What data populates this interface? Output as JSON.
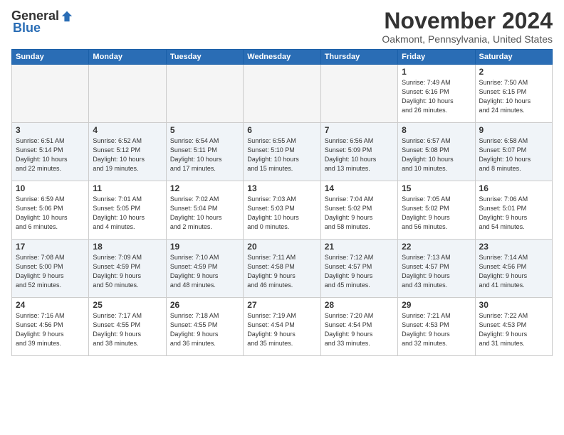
{
  "logo": {
    "general": "General",
    "blue": "Blue"
  },
  "header": {
    "month": "November 2024",
    "location": "Oakmont, Pennsylvania, United States"
  },
  "weekdays": [
    "Sunday",
    "Monday",
    "Tuesday",
    "Wednesday",
    "Thursday",
    "Friday",
    "Saturday"
  ],
  "weeks": [
    [
      {
        "day": "",
        "info": ""
      },
      {
        "day": "",
        "info": ""
      },
      {
        "day": "",
        "info": ""
      },
      {
        "day": "",
        "info": ""
      },
      {
        "day": "",
        "info": ""
      },
      {
        "day": "1",
        "info": "Sunrise: 7:49 AM\nSunset: 6:16 PM\nDaylight: 10 hours\nand 26 minutes."
      },
      {
        "day": "2",
        "info": "Sunrise: 7:50 AM\nSunset: 6:15 PM\nDaylight: 10 hours\nand 24 minutes."
      }
    ],
    [
      {
        "day": "3",
        "info": "Sunrise: 6:51 AM\nSunset: 5:14 PM\nDaylight: 10 hours\nand 22 minutes."
      },
      {
        "day": "4",
        "info": "Sunrise: 6:52 AM\nSunset: 5:12 PM\nDaylight: 10 hours\nand 19 minutes."
      },
      {
        "day": "5",
        "info": "Sunrise: 6:54 AM\nSunset: 5:11 PM\nDaylight: 10 hours\nand 17 minutes."
      },
      {
        "day": "6",
        "info": "Sunrise: 6:55 AM\nSunset: 5:10 PM\nDaylight: 10 hours\nand 15 minutes."
      },
      {
        "day": "7",
        "info": "Sunrise: 6:56 AM\nSunset: 5:09 PM\nDaylight: 10 hours\nand 13 minutes."
      },
      {
        "day": "8",
        "info": "Sunrise: 6:57 AM\nSunset: 5:08 PM\nDaylight: 10 hours\nand 10 minutes."
      },
      {
        "day": "9",
        "info": "Sunrise: 6:58 AM\nSunset: 5:07 PM\nDaylight: 10 hours\nand 8 minutes."
      }
    ],
    [
      {
        "day": "10",
        "info": "Sunrise: 6:59 AM\nSunset: 5:06 PM\nDaylight: 10 hours\nand 6 minutes."
      },
      {
        "day": "11",
        "info": "Sunrise: 7:01 AM\nSunset: 5:05 PM\nDaylight: 10 hours\nand 4 minutes."
      },
      {
        "day": "12",
        "info": "Sunrise: 7:02 AM\nSunset: 5:04 PM\nDaylight: 10 hours\nand 2 minutes."
      },
      {
        "day": "13",
        "info": "Sunrise: 7:03 AM\nSunset: 5:03 PM\nDaylight: 10 hours\nand 0 minutes."
      },
      {
        "day": "14",
        "info": "Sunrise: 7:04 AM\nSunset: 5:02 PM\nDaylight: 9 hours\nand 58 minutes."
      },
      {
        "day": "15",
        "info": "Sunrise: 7:05 AM\nSunset: 5:02 PM\nDaylight: 9 hours\nand 56 minutes."
      },
      {
        "day": "16",
        "info": "Sunrise: 7:06 AM\nSunset: 5:01 PM\nDaylight: 9 hours\nand 54 minutes."
      }
    ],
    [
      {
        "day": "17",
        "info": "Sunrise: 7:08 AM\nSunset: 5:00 PM\nDaylight: 9 hours\nand 52 minutes."
      },
      {
        "day": "18",
        "info": "Sunrise: 7:09 AM\nSunset: 4:59 PM\nDaylight: 9 hours\nand 50 minutes."
      },
      {
        "day": "19",
        "info": "Sunrise: 7:10 AM\nSunset: 4:59 PM\nDaylight: 9 hours\nand 48 minutes."
      },
      {
        "day": "20",
        "info": "Sunrise: 7:11 AM\nSunset: 4:58 PM\nDaylight: 9 hours\nand 46 minutes."
      },
      {
        "day": "21",
        "info": "Sunrise: 7:12 AM\nSunset: 4:57 PM\nDaylight: 9 hours\nand 45 minutes."
      },
      {
        "day": "22",
        "info": "Sunrise: 7:13 AM\nSunset: 4:57 PM\nDaylight: 9 hours\nand 43 minutes."
      },
      {
        "day": "23",
        "info": "Sunrise: 7:14 AM\nSunset: 4:56 PM\nDaylight: 9 hours\nand 41 minutes."
      }
    ],
    [
      {
        "day": "24",
        "info": "Sunrise: 7:16 AM\nSunset: 4:56 PM\nDaylight: 9 hours\nand 39 minutes."
      },
      {
        "day": "25",
        "info": "Sunrise: 7:17 AM\nSunset: 4:55 PM\nDaylight: 9 hours\nand 38 minutes."
      },
      {
        "day": "26",
        "info": "Sunrise: 7:18 AM\nSunset: 4:55 PM\nDaylight: 9 hours\nand 36 minutes."
      },
      {
        "day": "27",
        "info": "Sunrise: 7:19 AM\nSunset: 4:54 PM\nDaylight: 9 hours\nand 35 minutes."
      },
      {
        "day": "28",
        "info": "Sunrise: 7:20 AM\nSunset: 4:54 PM\nDaylight: 9 hours\nand 33 minutes."
      },
      {
        "day": "29",
        "info": "Sunrise: 7:21 AM\nSunset: 4:53 PM\nDaylight: 9 hours\nand 32 minutes."
      },
      {
        "day": "30",
        "info": "Sunrise: 7:22 AM\nSunset: 4:53 PM\nDaylight: 9 hours\nand 31 minutes."
      }
    ]
  ]
}
